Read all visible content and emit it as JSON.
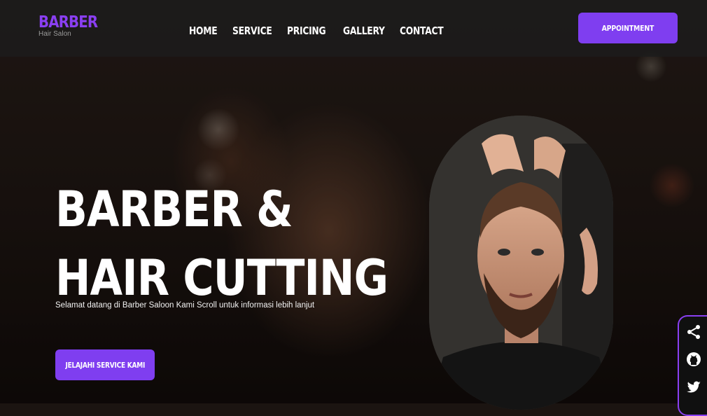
{
  "header": {
    "logo_title": "BARBER",
    "logo_subtitle": "Hair Salon",
    "nav": [
      {
        "label": "HOME"
      },
      {
        "label": "SERVICE"
      },
      {
        "label": "PRICING"
      },
      {
        "label": "GALLERY"
      },
      {
        "label": "CONTACT"
      }
    ],
    "appointment_label": "APPOINTMENT"
  },
  "hero": {
    "title_line1": "BARBER &",
    "title_line2": "HAIR CUTTING",
    "subtitle": "Selamat datang di Barber Saloon Kami Scroll untuk informasi lebih lanjut",
    "cta_label": "JELAJAHI SERVICE KAMI"
  },
  "social": {
    "icons": [
      "share-icon",
      "github-icon",
      "twitter-icon"
    ]
  },
  "colors": {
    "accent": "#7f3ef0",
    "logo": "#8a3ff2",
    "text": "#ffffff"
  }
}
